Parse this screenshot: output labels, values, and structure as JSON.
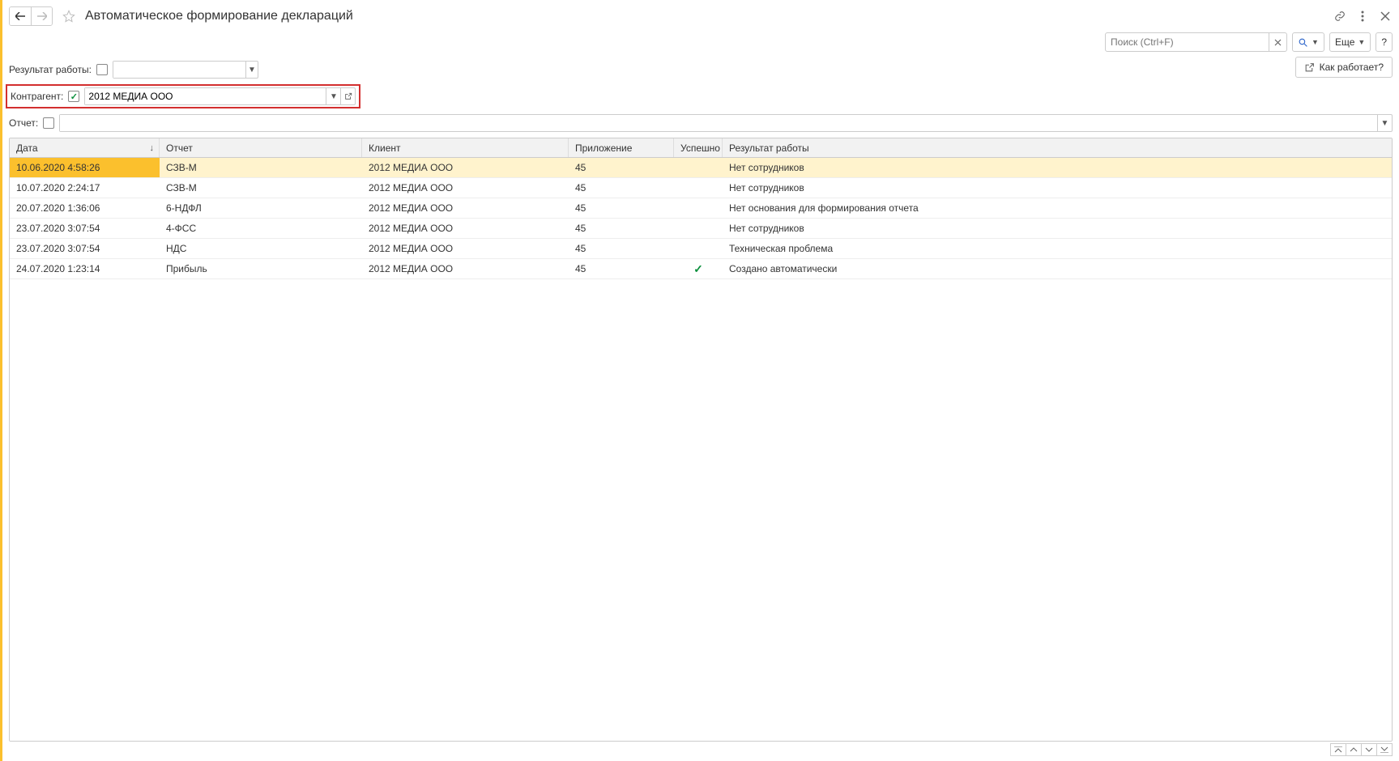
{
  "title": "Автоматическое формирование деклараций",
  "search": {
    "placeholder": "Поиск (Ctrl+F)",
    "more_label": "Еще",
    "help_label": "?"
  },
  "how_button": "Как работает?",
  "filters": {
    "result_label": "Результат работы:",
    "result_value": "",
    "contragent_label": "Контрагент:",
    "contragent_value": "2012 МЕДИА ООО",
    "report_label": "Отчет:",
    "report_value": ""
  },
  "columns": {
    "date": "Дата",
    "report": "Отчет",
    "client": "Клиент",
    "app": "Приложение",
    "ok": "Успешно",
    "result": "Результат работы"
  },
  "rows": [
    {
      "date": "10.06.2020 4:58:26",
      "report": "СЗВ-М",
      "client": "2012 МЕДИА ООО",
      "app": "45",
      "ok": false,
      "result": "Нет сотрудников",
      "selected": true
    },
    {
      "date": "10.07.2020 2:24:17",
      "report": "СЗВ-М",
      "client": "2012 МЕДИА ООО",
      "app": "45",
      "ok": false,
      "result": "Нет сотрудников"
    },
    {
      "date": "20.07.2020 1:36:06",
      "report": "6-НДФЛ",
      "client": "2012 МЕДИА ООО",
      "app": "45",
      "ok": false,
      "result": "Нет основания для формирования отчета"
    },
    {
      "date": "23.07.2020 3:07:54",
      "report": "4-ФСС",
      "client": "2012 МЕДИА ООО",
      "app": "45",
      "ok": false,
      "result": "Нет сотрудников"
    },
    {
      "date": "23.07.2020 3:07:54",
      "report": "НДС",
      "client": "2012 МЕДИА ООО",
      "app": "45",
      "ok": false,
      "result": "Техническая проблема"
    },
    {
      "date": "24.07.2020 1:23:14",
      "report": "Прибыль",
      "client": "2012 МЕДИА ООО",
      "app": "45",
      "ok": true,
      "result": "Создано автоматически"
    }
  ]
}
